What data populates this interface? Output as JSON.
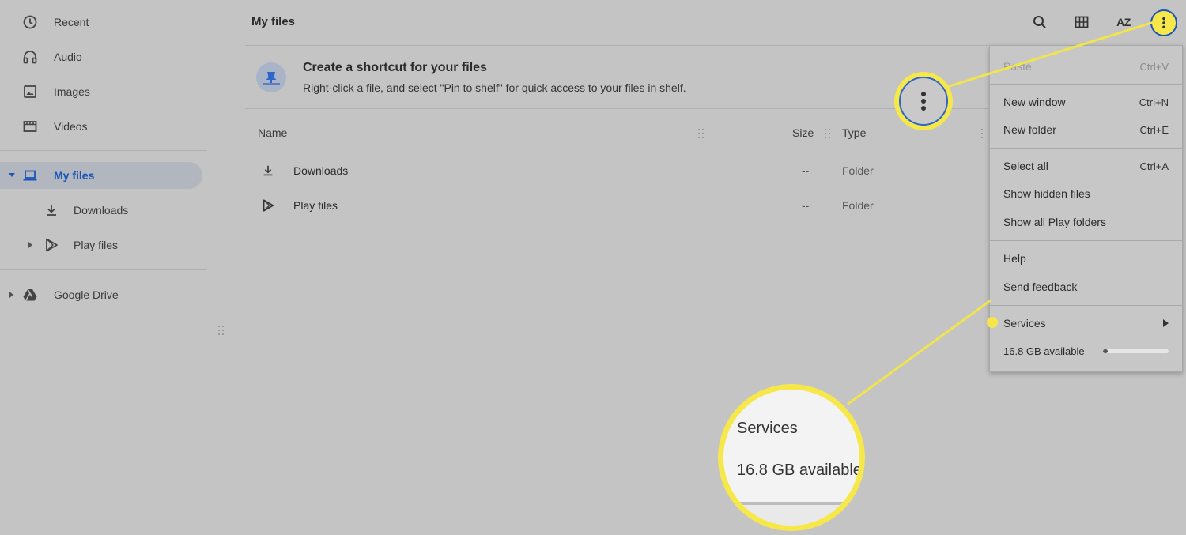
{
  "sidebar": {
    "items": [
      {
        "label": "Recent",
        "icon": "clock-icon"
      },
      {
        "label": "Audio",
        "icon": "headphones-icon"
      },
      {
        "label": "Images",
        "icon": "image-icon"
      },
      {
        "label": "Videos",
        "icon": "film-icon"
      },
      {
        "label": "My files",
        "icon": "laptop-icon"
      },
      {
        "label": "Downloads",
        "icon": "download-icon"
      },
      {
        "label": "Play files",
        "icon": "play-store-icon"
      },
      {
        "label": "Google Drive",
        "icon": "drive-icon"
      }
    ]
  },
  "header": {
    "title": "My files",
    "sort_label": "AZ"
  },
  "banner": {
    "title": "Create a shortcut for your files",
    "subtitle": "Right-click a file, and select \"Pin to shelf\" for quick access to your files in shelf."
  },
  "table": {
    "columns": [
      "Name",
      "Size",
      "Type"
    ],
    "rows": [
      {
        "name": "Downloads",
        "size": "--",
        "type": "Folder",
        "icon": "download-icon"
      },
      {
        "name": "Play files",
        "size": "--",
        "type": "Folder",
        "icon": "play-store-icon"
      }
    ]
  },
  "menu": {
    "paste": {
      "label": "Paste",
      "shortcut": "Ctrl+V"
    },
    "new_window": {
      "label": "New window",
      "shortcut": "Ctrl+N"
    },
    "new_folder": {
      "label": "New folder",
      "shortcut": "Ctrl+E"
    },
    "select_all": {
      "label": "Select all",
      "shortcut": "Ctrl+A"
    },
    "show_hidden": {
      "label": "Show hidden files"
    },
    "show_play": {
      "label": "Show all Play folders"
    },
    "help": {
      "label": "Help"
    },
    "feedback": {
      "label": "Send feedback"
    },
    "services": {
      "label": "Services"
    },
    "storage": {
      "label": "16.8 GB available",
      "used_fraction": 0.07
    }
  },
  "zoom": {
    "line1": "Services",
    "line2": "16.8 GB available"
  },
  "colors": {
    "callout": "#f6e84a",
    "accent": "#1a56b8"
  }
}
